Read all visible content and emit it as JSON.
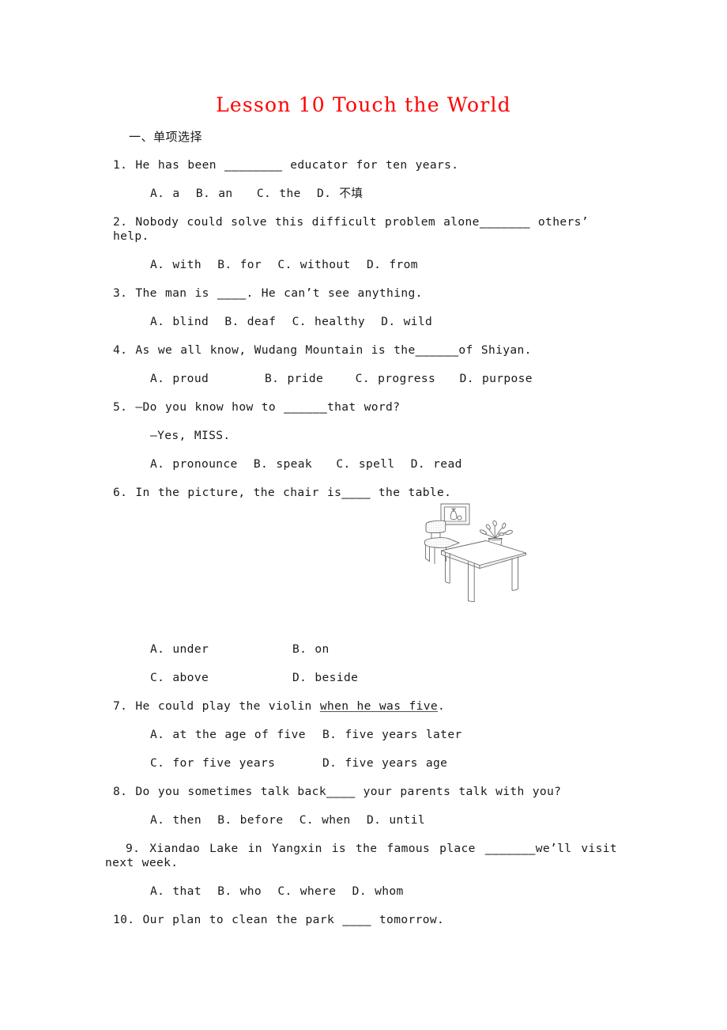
{
  "document": {
    "title": "Lesson 10 Touch the World",
    "title_color": "#ff0000",
    "section_heading": "一、单项选择"
  },
  "questions": [
    {
      "number": "1.",
      "stem_before": "1. He has been ",
      "blank": "________",
      "stem_after": " educator for ten years.",
      "options_line": "A. a  B. an   C. the  D. 不填"
    },
    {
      "number": "2.",
      "stem_before": "2. Nobody could solve this difficult problem alone",
      "blank": "_______",
      "stem_after": " others’ help.",
      "options_line": "A. with  B. for  C. without  D. from"
    },
    {
      "number": "3.",
      "stem_before": "3. The man is ",
      "blank": "____",
      "stem_after": ". He can’t see anything.",
      "options_line": "A. blind  B. deaf  C. healthy  D. wild"
    },
    {
      "number": "4.",
      "stem_before": "4. As we all know, Wudang Mountain is the",
      "blank": "______",
      "stem_after": "of Shiyan.",
      "options_line": "A. proud       B. pride    C. progress   D. purpose"
    },
    {
      "number": "5.",
      "stem_before": "5. —Do you know how to ",
      "blank": "______",
      "stem_after": "that word?",
      "stem_line2": "—Yes, MISS.",
      "options_line": "A. pronounce  B. speak   C. spell  D. read"
    },
    {
      "number": "6.",
      "stem_before": "6. In the picture, the chair is",
      "blank": "____",
      "stem_after": " the table.",
      "options_grid": [
        {
          "left": "A. under",
          "right": "B. on"
        },
        {
          "left": "C. above",
          "right": "D. beside"
        }
      ]
    },
    {
      "number": "7.",
      "stem_before": "7. He could play the violin ",
      "underlined": "when he was five",
      "stem_after": ".",
      "options_grid": [
        {
          "left": "A. at the age of five",
          "right": "B. five years later"
        },
        {
          "left": "C. for five years",
          "right": "D. five years age"
        }
      ]
    },
    {
      "number": "8.",
      "stem_before": "8. Do you sometimes talk back",
      "blank": "____",
      "stem_after": " your parents talk with you?",
      "options_line": "A. then  B. before  C. when  D. until"
    },
    {
      "number": "9.",
      "stem_before": "9. Xiandao Lake in Yangxin is the famous place ",
      "blank": "_______",
      "stem_after": "we’ll visit next week.",
      "options_line": "A. that  B. who  C. where  D. whom"
    },
    {
      "number": "10.",
      "stem_before": "10. Our plan to clean the park ",
      "blank": "____",
      "stem_after": " tomorrow.",
      "options_line": ""
    }
  ],
  "figure": {
    "name": "room-scene-line-drawing",
    "description": "Line drawing of a table with a potted plant on it, a chair beside it, and a framed picture on the wall",
    "parts": [
      "framed-picture",
      "chair",
      "table",
      "potted-plant"
    ],
    "stroke_color": "#6b6b6b"
  }
}
